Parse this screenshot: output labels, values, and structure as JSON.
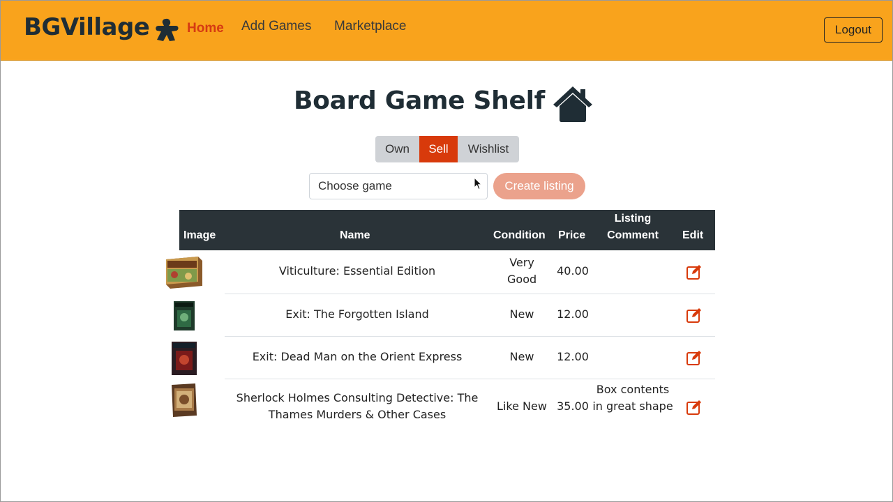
{
  "nav": {
    "brand": "BGVillage",
    "links": {
      "home": "Home",
      "add_games": "Add Games",
      "marketplace": "Marketplace"
    },
    "logout": "Logout"
  },
  "page": {
    "title": "Board Game Shelf",
    "tabs": {
      "own": "Own",
      "sell": "Sell",
      "wishlist": "Wishlist"
    },
    "active_tab": "Sell",
    "select_placeholder": "Choose game",
    "create_button": "Create listing"
  },
  "table": {
    "headers": {
      "image": "Image",
      "name": "Name",
      "condition": "Condition",
      "price": "Price",
      "comment": "Listing Comment",
      "edit": "Edit"
    },
    "rows": [
      {
        "name": "Viticulture: Essential Edition",
        "condition": "Very Good",
        "price": "40.00",
        "comment": ""
      },
      {
        "name": "Exit: The Forgotten Island",
        "condition": "New",
        "price": "12.00",
        "comment": ""
      },
      {
        "name": "Exit: Dead Man on the Orient Express",
        "condition": "New",
        "price": "12.00",
        "comment": ""
      },
      {
        "name": "Sherlock Holmes Consulting Detective: The Thames Murders & Other Cases",
        "condition": "Like New",
        "price": "35.00",
        "comment": "Box contents in great shape"
      }
    ]
  },
  "colors": {
    "navbar": "#f9a31c",
    "accent": "#d83a0b",
    "header": "#2a3338"
  }
}
